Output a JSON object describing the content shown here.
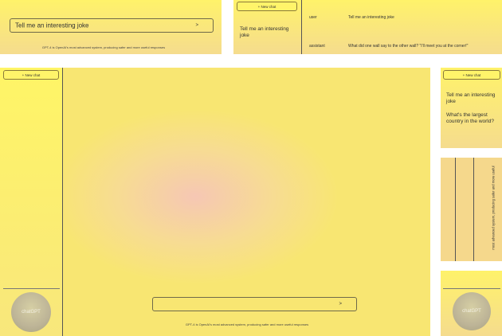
{
  "p1": {
    "prompt_text": "Tell me an interesting joke",
    "send": ">",
    "footer": "GPT-4 is OpenAI's most advanced system, producing safer and more useful responses"
  },
  "p2": {
    "new_chat": "+ New chat",
    "history": [
      "Tell me an interesting joke"
    ],
    "messages": [
      {
        "role": "user",
        "text": "Tell me an interesting joke"
      },
      {
        "role": "assistant",
        "text": "What did one wall say to the other wall? \"I'll meet you at the corner!\""
      }
    ]
  },
  "main": {
    "new_chat": "+ New chat",
    "avatar": "chatGPT",
    "send": ">",
    "footer": "GPT-4 is OpenAI's most advanced system, producing safer and more useful responses"
  },
  "r1": {
    "new_chat": "+ New chat",
    "history": [
      "Tell me an interesting joke",
      "What's the largest country in the world?"
    ]
  },
  "r2": {
    "vertical_text": "most advanced system, producing safer and more useful"
  },
  "r3": {
    "avatar": "chatGPT"
  }
}
